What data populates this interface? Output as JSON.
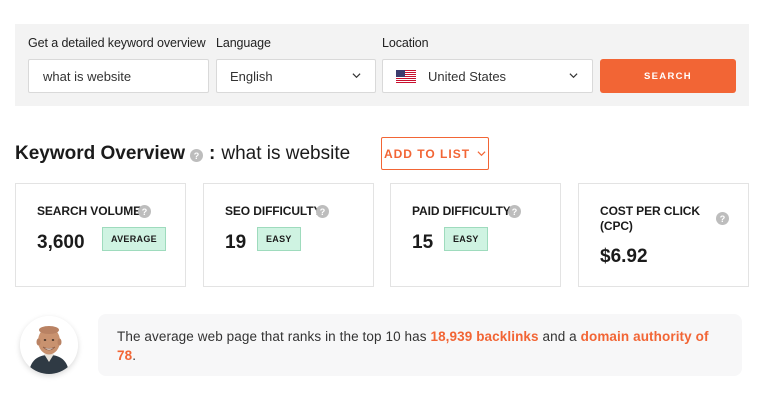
{
  "search": {
    "keyword_label": "Get a detailed keyword overview",
    "keyword_value": "what is website",
    "language_label": "Language",
    "language_value": "English",
    "location_label": "Location",
    "location_value": "United States",
    "button_label": "SEARCH",
    "accent_color": "#f26535"
  },
  "overview": {
    "title": "Keyword Overview",
    "colon": ":",
    "keyword": "what is website",
    "add_to_list_label": "ADD TO LIST"
  },
  "metrics": [
    {
      "title": "SEARCH VOLUME",
      "value": "3,600",
      "badge": "AVERAGE"
    },
    {
      "title": "SEO DIFFICULTY",
      "value": "19",
      "badge": "EASY"
    },
    {
      "title": "PAID DIFFICULTY",
      "value": "15",
      "badge": "EASY"
    },
    {
      "title_line1": "COST PER CLICK",
      "title_line2": "(CPC)",
      "value": "$6.92"
    }
  ],
  "insight": {
    "text_before": "The average web page that ranks in the top 10 has ",
    "backlinks": "18,939 backlinks",
    "text_middle": " and a ",
    "domain_authority": "domain authority of 78",
    "text_after": "."
  },
  "icons": {
    "help": "?",
    "flag": "us-flag-icon",
    "chevron": "chevron-down-icon"
  }
}
